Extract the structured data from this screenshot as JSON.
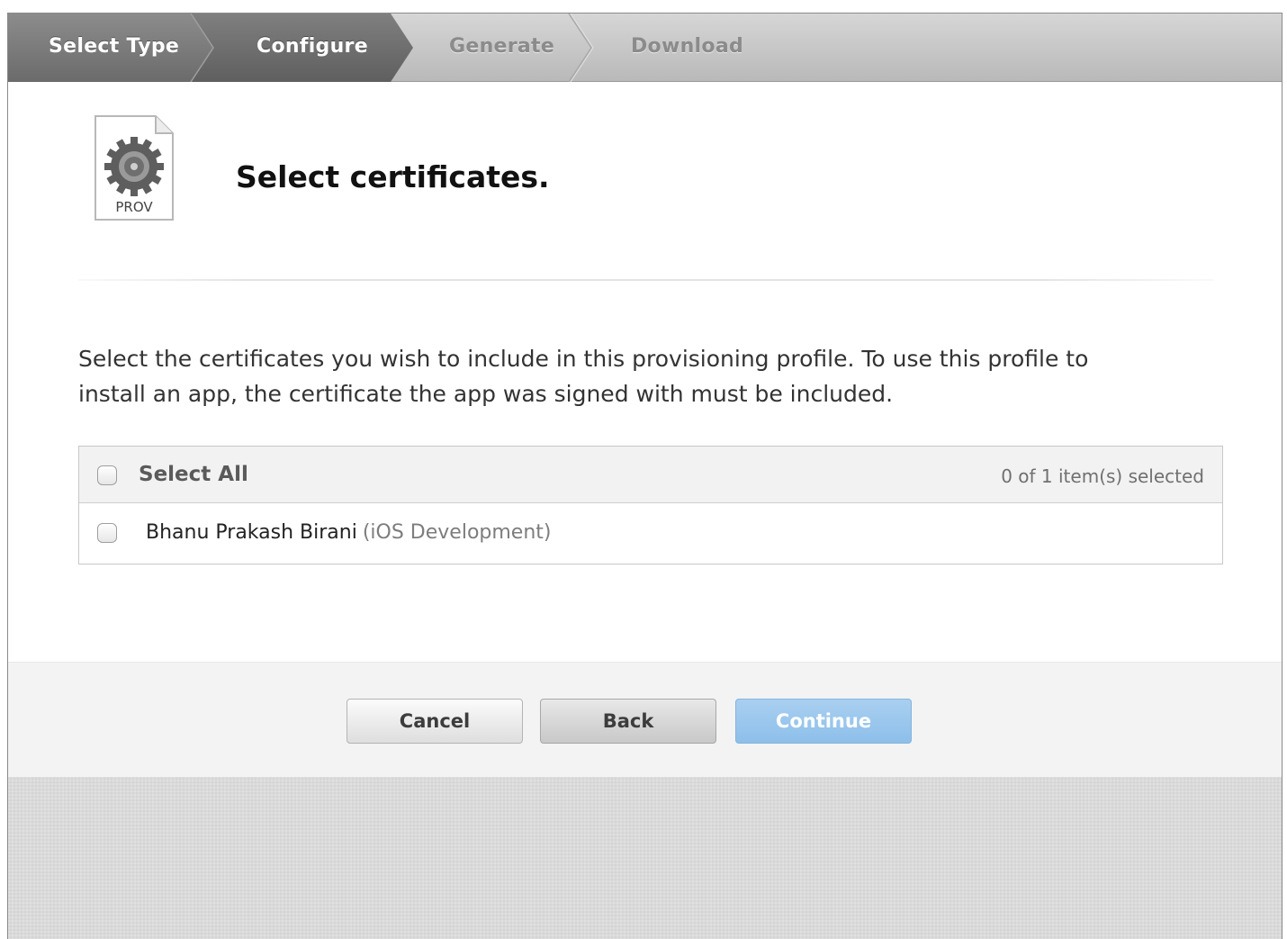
{
  "steps": [
    {
      "label": "Select Type",
      "state": "completed"
    },
    {
      "label": "Configure",
      "state": "active"
    },
    {
      "label": "Generate",
      "state": "pending"
    },
    {
      "label": "Download",
      "state": "pending"
    }
  ],
  "doc_icon": {
    "label": "PROV",
    "icon": "gear-icon"
  },
  "header": {
    "title": "Select certificates."
  },
  "description": "Select the certificates you wish to include in this provisioning profile. To use this profile to install an app, the certificate the app was signed with must be included.",
  "certificates": {
    "select_all_label": "Select All",
    "selected_count": "0 of 1 item(s) selected",
    "items": [
      {
        "name": "Bhanu Prakash Birani",
        "type": "(iOS Development)",
        "checked": false
      }
    ]
  },
  "buttons": {
    "cancel": "Cancel",
    "back": "Back",
    "continue": "Continue"
  },
  "colors": {
    "active_step": "#7a7a7a",
    "continue_button": "#9cc6ec"
  }
}
